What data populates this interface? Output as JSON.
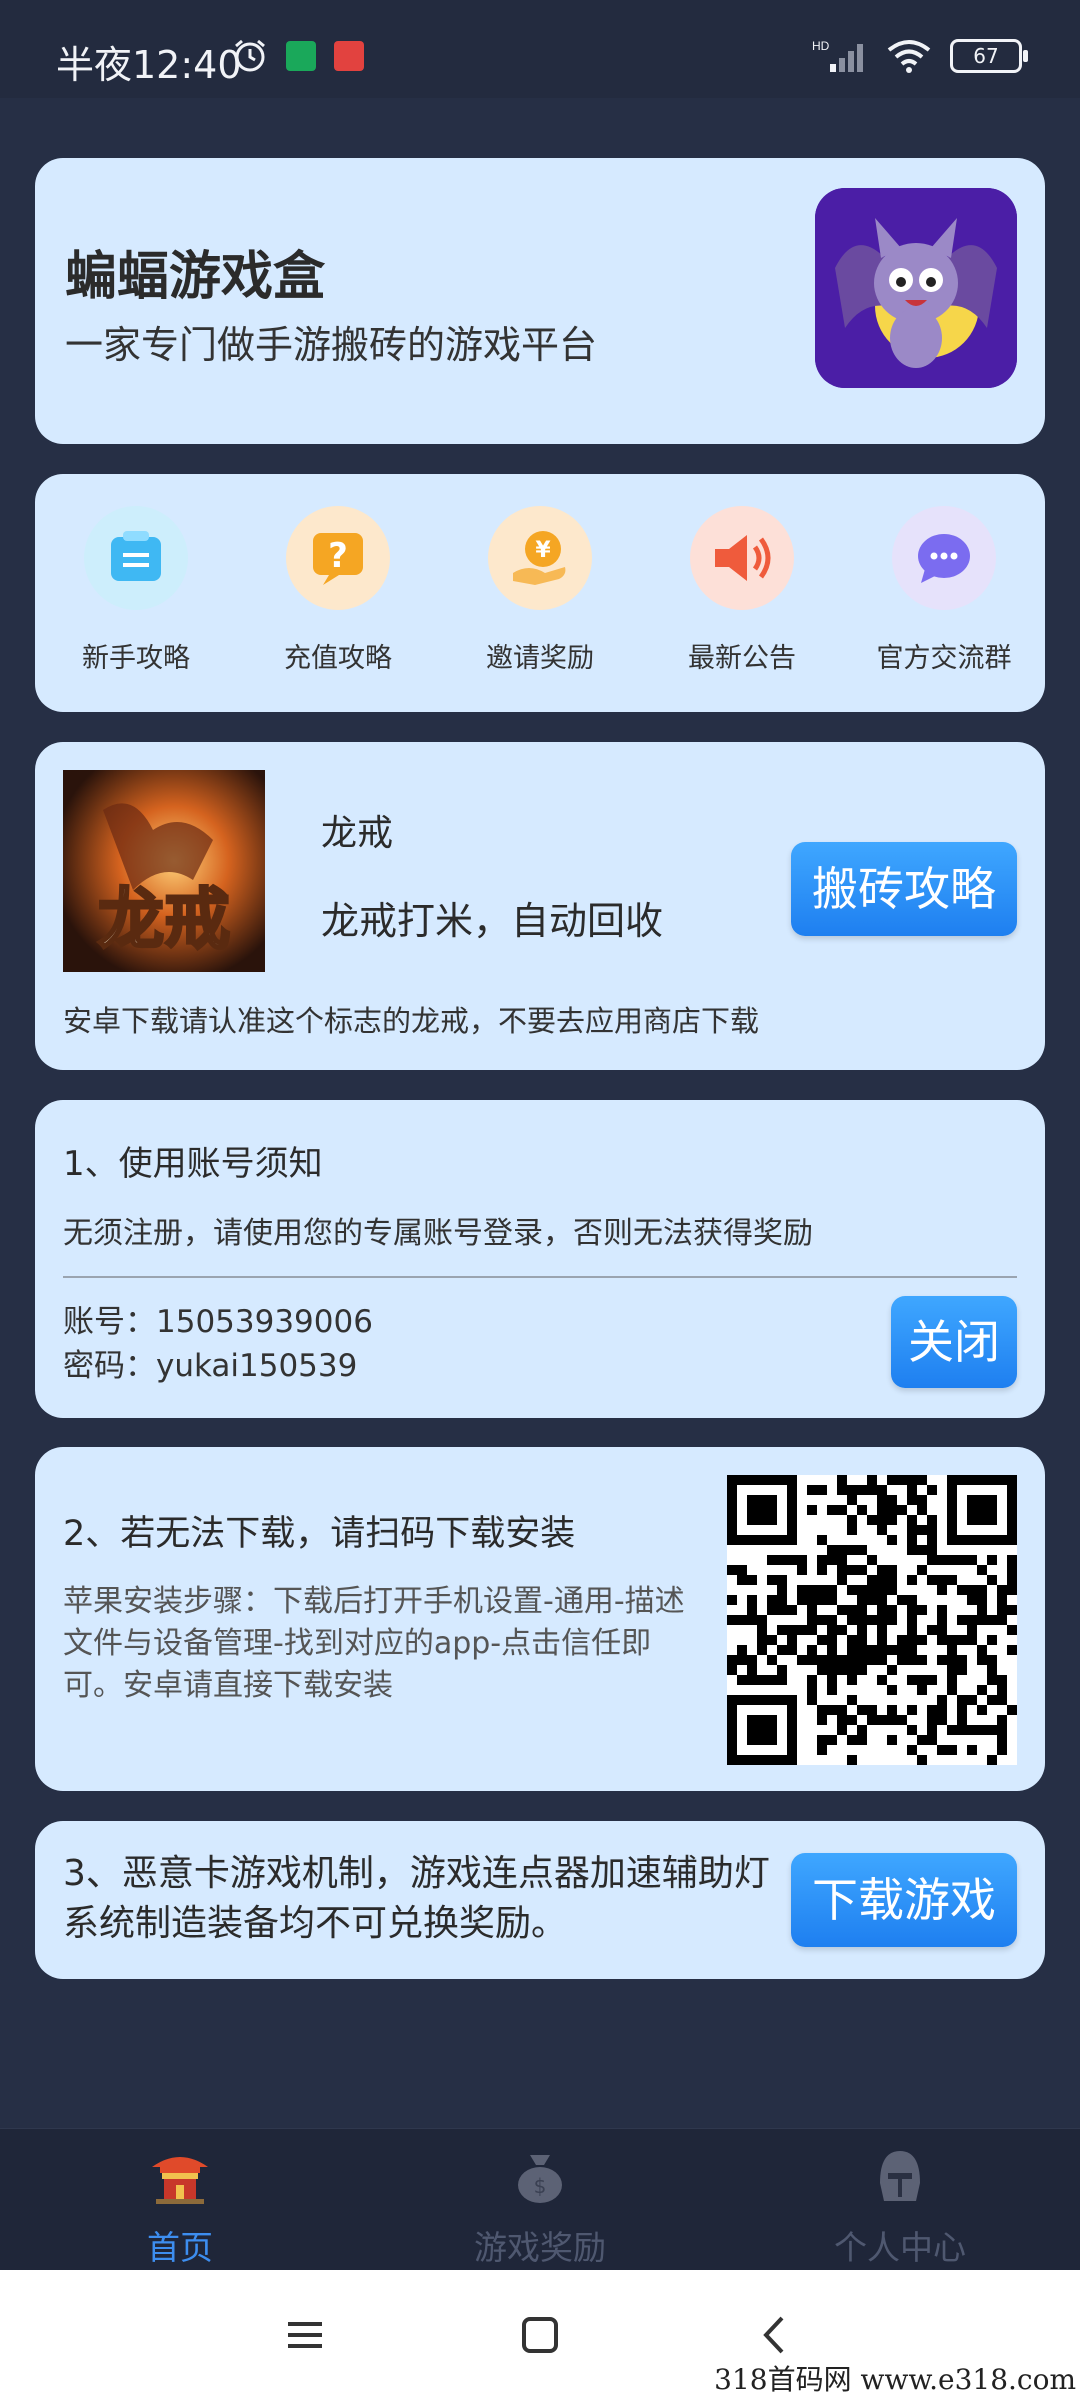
{
  "status_bar": {
    "time": "半夜12:40",
    "network": "HD",
    "battery": "67"
  },
  "header": {
    "title": "蝙蝠游戏盒",
    "subtitle": "一家专门做手游搬砖的游戏平台",
    "logo_icon": "bat-mascot-icon"
  },
  "quick_menu": [
    {
      "label": "新手攻略",
      "icon": "document-icon",
      "color": "#3fb8f3"
    },
    {
      "label": "充值攻略",
      "icon": "question-icon",
      "color": "#f5a623"
    },
    {
      "label": "邀请奖励",
      "icon": "coin-hand-icon",
      "color": "#f5a623"
    },
    {
      "label": "最新公告",
      "icon": "speaker-icon",
      "color": "#ef5b3c"
    },
    {
      "label": "官方交流群",
      "icon": "chat-icon",
      "color": "#7b6cf0"
    }
  ],
  "game": {
    "name": "龙戒",
    "description": "龙戒打米，自动回收",
    "button": "搬砖攻略",
    "notice": "安卓下载请认准这个标志的龙戒，不要去应用商店下载",
    "image_text": "龙戒"
  },
  "account": {
    "title": "1、使用账号须知",
    "note": "无须注册，请使用您的专属账号登录，否则无法获得奖励",
    "username_line": "账号：15053939006",
    "password_line": "密码：yukai150539",
    "close_button": "关闭"
  },
  "download": {
    "title": "2、若无法下载，请扫码下载安装",
    "description": "苹果安装步骤：下载后打开手机设置-通用-描述文件与设备管理-找到对应的app-点击信任即可。安卓请直接下载安装"
  },
  "rules": {
    "text": "3、恶意卡游戏机制，游戏连点器加速辅助灯系统制造装备均不可兑换奖励。",
    "button": "下载游戏"
  },
  "bottom_nav": [
    {
      "label": "首页",
      "icon": "temple-icon",
      "active": true
    },
    {
      "label": "游戏奖励",
      "icon": "money-bag-icon",
      "active": false
    },
    {
      "label": "个人中心",
      "icon": "helmet-icon",
      "active": false
    }
  ],
  "watermark": "318首码网 www.e318.com",
  "colors": {
    "accent": "#3d8ef0",
    "card": "#d6eaff",
    "background": "#262f45"
  }
}
